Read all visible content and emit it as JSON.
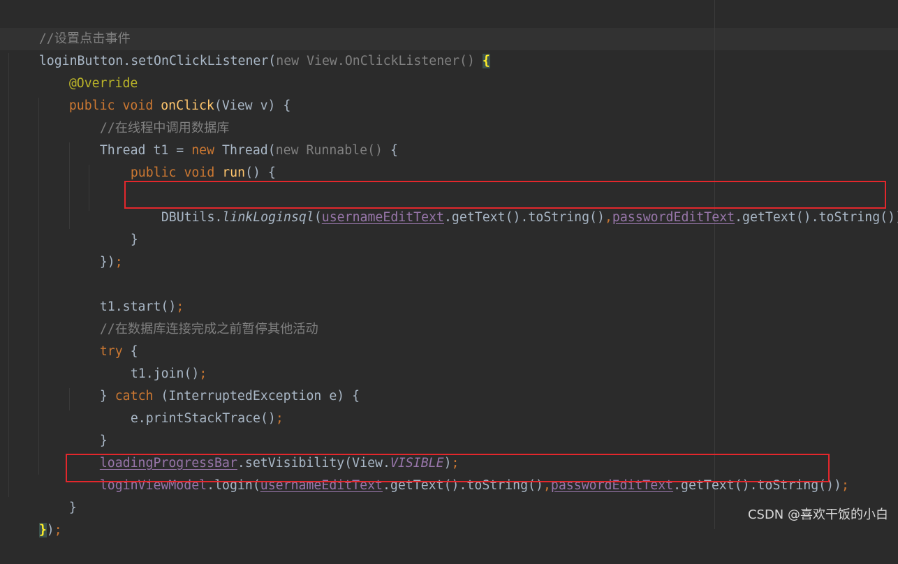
{
  "editor": {
    "colors": {
      "background": "#2b2b2b",
      "default_text": "#a9b7c6",
      "keyword": "#cc7832",
      "comment": "#808080",
      "method_declaration": "#ffc66d",
      "annotation": "#bbb529",
      "field": "#9876aa",
      "highlight_box": "#e3272c",
      "brace_match": "#ffef28"
    },
    "lines": {
      "l1": {
        "comment": "//设置点击事件"
      },
      "l2": {
        "a": "loginButton.setOnClickListener(",
        "b": "new View.OnClickListener()",
        "c": " ",
        "brace": "{"
      },
      "l3": {
        "annotation": "@Override"
      },
      "l4": {
        "kw1": "public",
        "kw2": " void ",
        "method": "onClick",
        "rest": "(View v) {"
      },
      "l5": {
        "comment": "//在线程中调用数据库"
      },
      "l6": {
        "a": "Thread t1 = ",
        "kw": "new",
        "b": " Thread(",
        "c": "new Runnable()",
        "d": " {"
      },
      "l7": {
        "kw1": "public",
        "kw2": " void ",
        "method": "run",
        "rest": "() {"
      },
      "l9": {
        "a": "DBUtils.",
        "static_method": "linkLoginsql",
        "b": "(",
        "field1": "usernameEditText",
        "c": ".getText().toString()",
        "comma": ",",
        "field2": "passwordEditText",
        "d": ".getText().toString())",
        "semi": ";"
      },
      "l10": {
        "text": "}"
      },
      "l11": {
        "a": "})",
        "semi": ";"
      },
      "l13": {
        "a": "t1.start()",
        "semi": ";"
      },
      "l14": {
        "comment": "//在数据库连接完成之前暂停其他活动"
      },
      "l15": {
        "kw": "try",
        "rest": " {"
      },
      "l16": {
        "a": "t1.join()",
        "semi": ";"
      },
      "l17": {
        "a": "} ",
        "kw": "catch",
        "rest": " (InterruptedException e) {"
      },
      "l18": {
        "a": "e.printStackTrace()",
        "semi": ";"
      },
      "l19": {
        "text": "}"
      },
      "l20": {
        "field": "loadingProgressBar",
        "a": ".setVisibility(View.",
        "static": "VISIBLE",
        "b": ")",
        "semi": ";"
      },
      "l21": {
        "field_plain": "loginViewModel",
        "a": ".login(",
        "field1": "usernameEditText",
        "b": ".getText().toString()",
        "comma": ",",
        "field2": "passwordEditText",
        "c": ".getText().toString())",
        "semi": ";"
      },
      "l22": {
        "text": "}"
      },
      "l23": {
        "brace": "}",
        "a": ")",
        "semi": ";"
      }
    }
  },
  "watermark": {
    "text": "CSDN @喜欢干饭的小白"
  }
}
